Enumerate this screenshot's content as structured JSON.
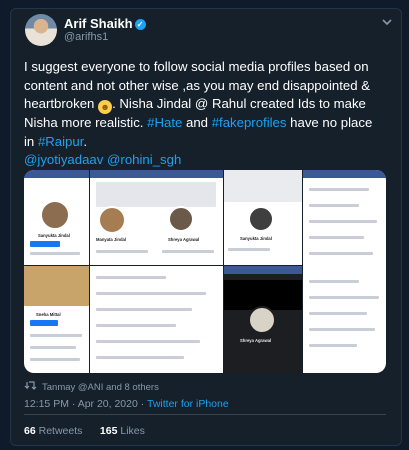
{
  "tweet": {
    "author_name": "Arif Shaikh",
    "author_handle": "@arifhs1",
    "body": {
      "part1": "I suggest everyone to follow social media profiles based on content and not other wise ,as you may end disappointed & heartbroken",
      "part2": ". Nisha Jindal @ Rahul created Ids to make Nisha more realistic.",
      "link_hate": "#Hate",
      "and": "and",
      "link_fake": "#fakeprofiles",
      "middle": "have no place in",
      "link_raipur": "#Raipur",
      "dot": ".",
      "mention1": "@jyotiyadaav",
      "mention2": "@rohini_sgh"
    },
    "retweet_line": "Tanmay @ANI and 8 others",
    "time": "12:15 PM · Apr 20, 2020",
    "source": "Twitter for iPhone",
    "retweets_count": "66",
    "retweets_label": "Retweets",
    "likes_count": "165",
    "likes_label": "Likes"
  },
  "media": {
    "screenshots": [
      {
        "profile_name": "Sanyukta Jindal"
      },
      {
        "profile_name": "Manyata Jindal"
      },
      {
        "profile_name": "Shreya Agrawal"
      },
      {
        "profile_name": "Sanyukta Jindal"
      },
      {
        "profile_name": "Sneha Mittal"
      },
      {
        "profile_name": "Shreya Agrawal"
      }
    ]
  },
  "colors": {
    "background": "#15202b",
    "link": "#1da1f2",
    "secondary_text": "#8899a6",
    "facebook_blue": "#3b5998"
  }
}
